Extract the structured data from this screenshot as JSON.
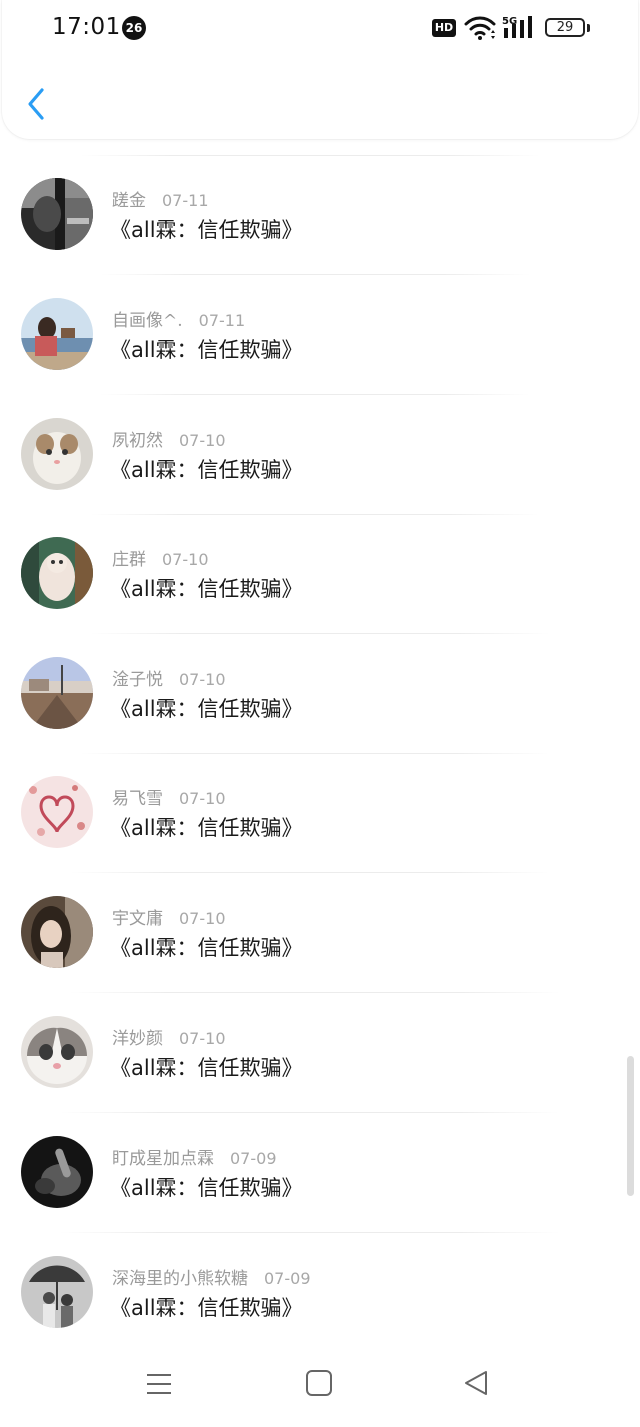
{
  "status_bar": {
    "time": "17:01",
    "notification_count": "26",
    "hd_label": "HD",
    "network_label": "5G",
    "battery": "29"
  },
  "header": {
    "back_icon": "chevron-left-icon",
    "accent_color": "#2a9df4"
  },
  "list": {
    "items": [
      {
        "name": "蹉金",
        "date": "07-11",
        "title": "《all霖：信任欺骗》",
        "avatar": "dark-portrait"
      },
      {
        "name": "自画像^.",
        "date": "07-11",
        "title": "《all霖：信任欺骗》",
        "avatar": "girl-by-sea"
      },
      {
        "name": "夙初然",
        "date": "07-10",
        "title": "《all霖：信任欺骗》",
        "avatar": "kitten"
      },
      {
        "name": "庄群",
        "date": "07-10",
        "title": "《all霖：信任欺骗》",
        "avatar": "cat-figure"
      },
      {
        "name": "淦子悦",
        "date": "07-10",
        "title": "《all霖：信任欺骗》",
        "avatar": "railway-dusk"
      },
      {
        "name": "易飞雪",
        "date": "07-10",
        "title": "《all霖：信任欺骗》",
        "avatar": "pink-heart"
      },
      {
        "name": "宇文庸",
        "date": "07-10",
        "title": "《all霖：信任欺骗》",
        "avatar": "girl-portrait"
      },
      {
        "name": "洋妙颜",
        "date": "07-10",
        "title": "《all霖：信任欺骗》",
        "avatar": "cat-face"
      },
      {
        "name": "盯成星加点霖",
        "date": "07-09",
        "title": "《all霖：信任欺骗》",
        "avatar": "dark-hand"
      },
      {
        "name": "深海里的小熊软糖",
        "date": "07-09",
        "title": "《all霖：信任欺骗》",
        "avatar": "couple-umbrella"
      }
    ]
  },
  "nav_bar": {
    "menu_icon": "menu-icon",
    "home_icon": "home-square-icon",
    "back_icon": "back-triangle-icon"
  }
}
